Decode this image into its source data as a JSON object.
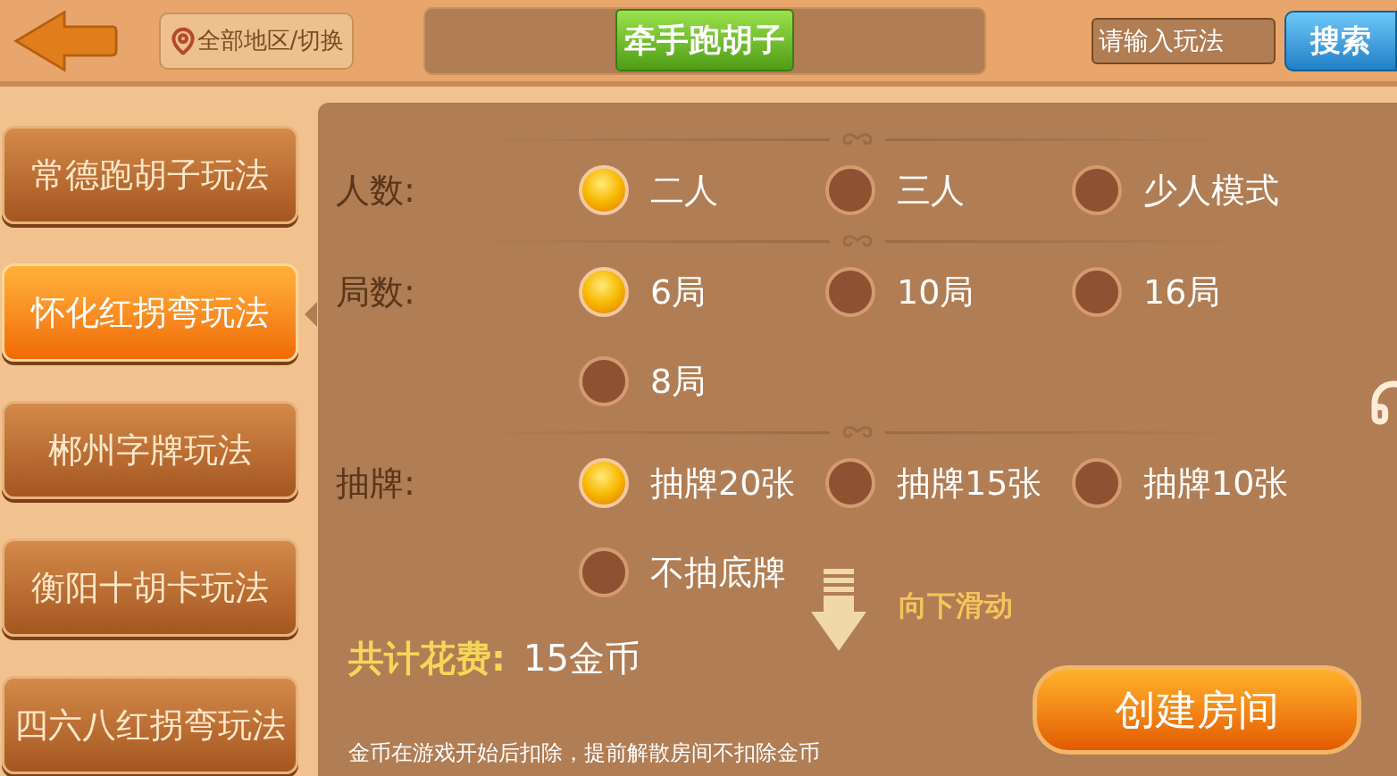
{
  "top_bar": {
    "region_button": "全部地区/切换",
    "game_title": "牵手跑胡子",
    "search": {
      "placeholder": "请输入玩法"
    },
    "search_button": "搜索"
  },
  "sidebar": {
    "items": [
      {
        "label": "常德跑胡子玩法",
        "selected": false
      },
      {
        "label": "怀化红拐弯玩法",
        "selected": true
      },
      {
        "label": "郴州字牌玩法",
        "selected": false
      },
      {
        "label": "衡阳十胡卡玩法",
        "selected": false
      },
      {
        "label": "四六八红拐弯玩法",
        "selected": false
      }
    ]
  },
  "options": [
    {
      "label": "人数:",
      "choices": [
        {
          "label": "二人",
          "selected": true
        },
        {
          "label": "三人",
          "selected": false
        },
        {
          "label": "少人模式",
          "selected": false
        }
      ]
    },
    {
      "label": "局数:",
      "choices": [
        {
          "label": "6局",
          "selected": true
        },
        {
          "label": "10局",
          "selected": false
        },
        {
          "label": "16局",
          "selected": false
        },
        {
          "label": "8局",
          "selected": false
        }
      ]
    },
    {
      "label": "抽牌:",
      "choices": [
        {
          "label": "抽牌20张",
          "selected": true
        },
        {
          "label": "抽牌15张",
          "selected": false
        },
        {
          "label": "抽牌10张",
          "selected": false
        },
        {
          "label": "不抽底牌",
          "selected": false
        }
      ]
    }
  ],
  "scroll_hint": "向下滑动",
  "cost": {
    "label": "共计花费:",
    "value": "15金币"
  },
  "create_button": "创建房间",
  "note": "金币在游戏开始后扣除，提前解散房间不扣除金币"
}
